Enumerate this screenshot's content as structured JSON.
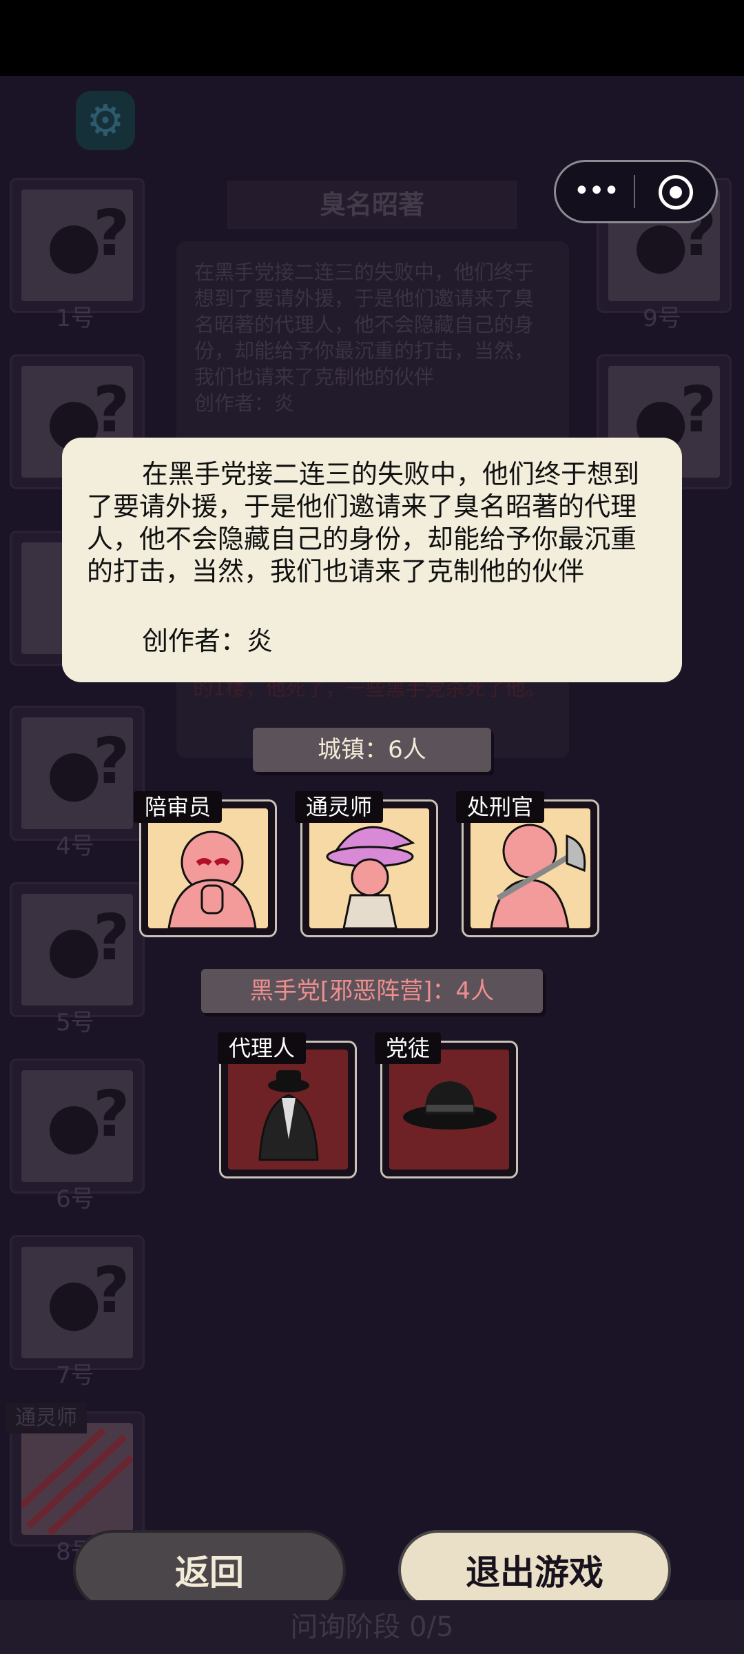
{
  "header": {
    "settings_icon": "gear-icon"
  },
  "title": "臭名昭著",
  "bg_story": "在黑手党接二连三的失败中，他们终于想到了要请外援，于是他们邀请来了臭名昭著的代理人，他不会隐藏自己的身份，却能给予你最沉重的打击，当然，我们也请来了克制他的伙伴",
  "bg_author": "创作者：炎",
  "bg_red_text": "的1楼，他死了，一些黑手党杀死了他。",
  "capsule": {
    "more_icon": "more-dots-icon",
    "close_icon": "target-icon"
  },
  "players_left": [
    {
      "num": "1号"
    },
    {
      "num": ""
    },
    {
      "num": ""
    },
    {
      "num": "4号"
    },
    {
      "num": "5号"
    },
    {
      "num": "6号"
    },
    {
      "num": "7号"
    },
    {
      "num": "8号"
    }
  ],
  "players_right": [
    {
      "num": "9号"
    },
    {
      "num": ""
    }
  ],
  "player8_role": "通灵师",
  "popup": {
    "story": "在黑手党接二连三的失败中，他们终于想到了要请外援，于是他们邀请来了臭名昭著的代理人，他不会隐藏自己的身份，却能给予你最沉重的打击，当然，我们也请来了克制他的伙伴",
    "author": "创作者：炎"
  },
  "town": {
    "header": "城镇：6人",
    "roles": [
      {
        "name": "陪审员"
      },
      {
        "name": "通灵师"
      },
      {
        "name": "处刑官"
      }
    ]
  },
  "mafia": {
    "header": "黑手党[邪恶阵营]：4人",
    "roles": [
      {
        "name": "代理人"
      },
      {
        "name": "党徒"
      }
    ]
  },
  "buttons": {
    "back": "返回",
    "exit": "退出游戏"
  },
  "phase": "问询阶段 0/5",
  "colors": {
    "town_card": "#f6d9a4",
    "mafia_card": "#6e2225",
    "mafia_header": "#ef8e8e",
    "town_header": "#f3ead7"
  }
}
